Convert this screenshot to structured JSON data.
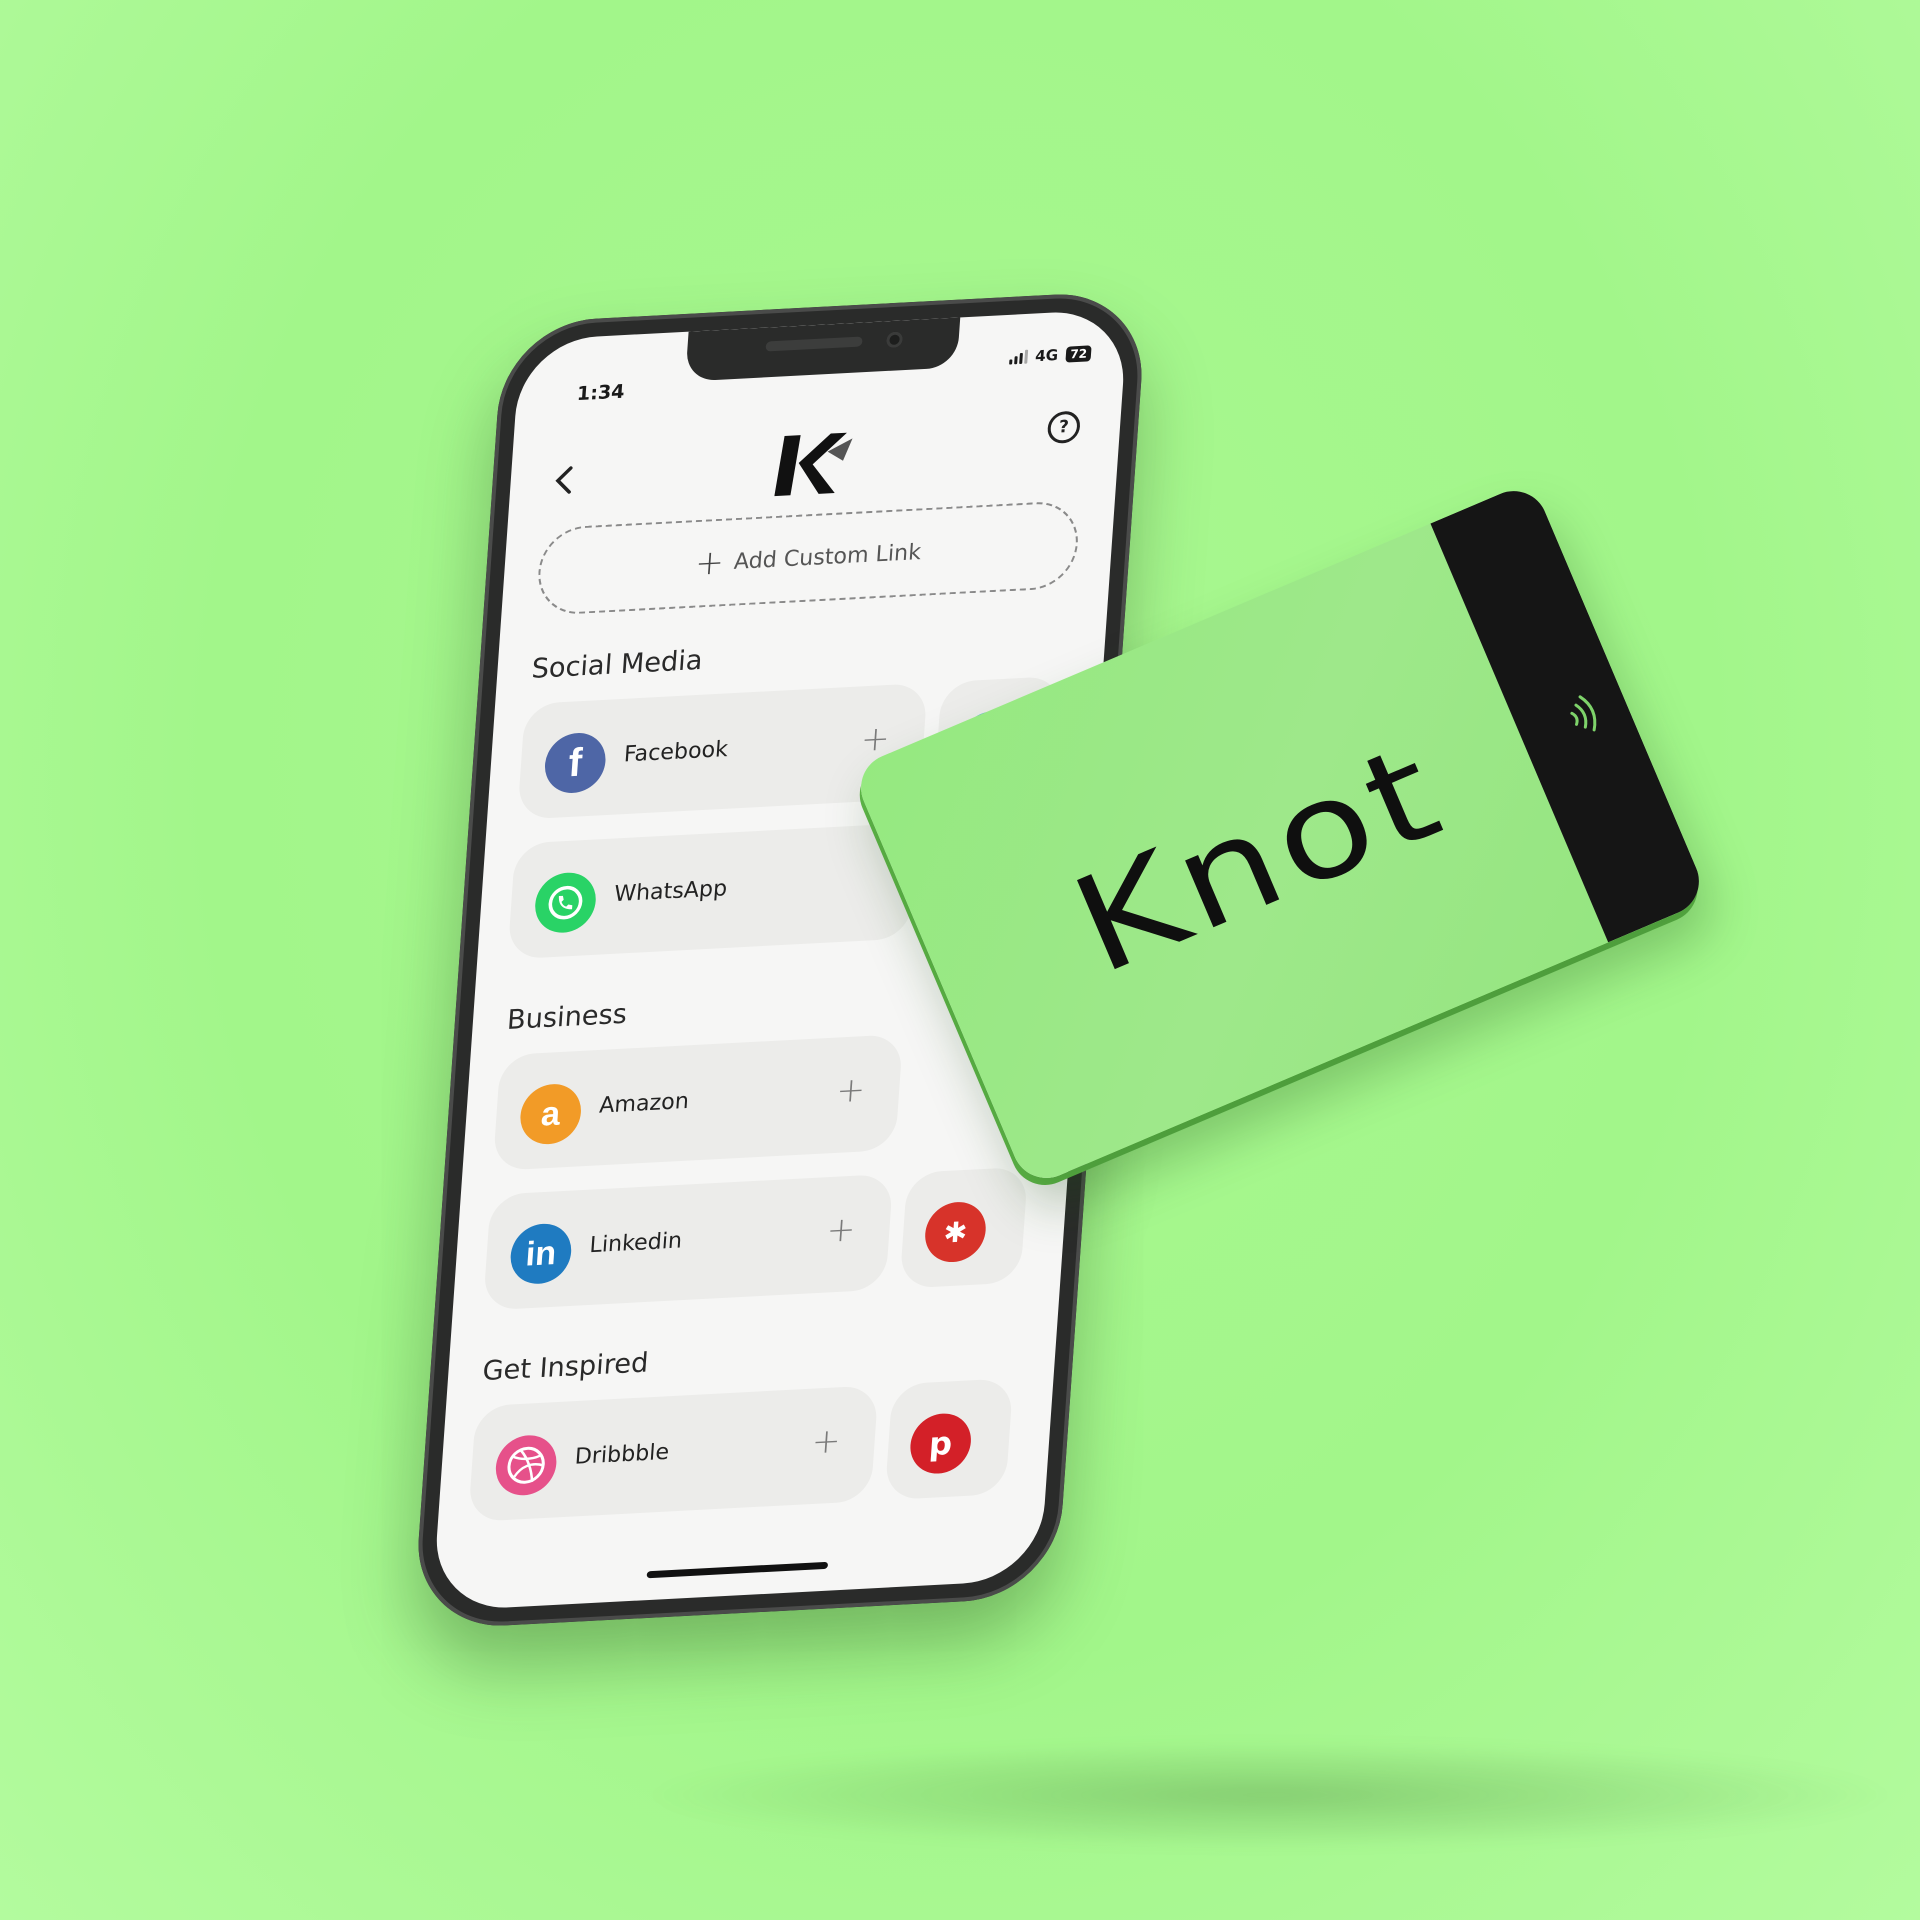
{
  "status_bar": {
    "time": "1:34",
    "network": "4G",
    "battery": "72"
  },
  "header": {
    "back_icon": "chevron-left-icon",
    "logo_icon": "knot-logo-icon",
    "help_icon": "question-icon"
  },
  "custom_link": {
    "label": "Add Custom Link"
  },
  "sections": {
    "social": {
      "title": "Social Media"
    },
    "business": {
      "title": "Business"
    },
    "inspired": {
      "title": "Get Inspired"
    }
  },
  "links": {
    "facebook": {
      "label": "Facebook",
      "icon": "facebook-icon",
      "color": "#4e66a6"
    },
    "whatsapp": {
      "label": "WhatsApp",
      "icon": "whatsapp-icon",
      "color": "#29d366"
    },
    "amazon": {
      "label": "Amazon",
      "icon": "amazon-icon",
      "color": "#f29b27"
    },
    "linkedin": {
      "label": "Linkedin",
      "icon": "linkedin-icon",
      "color": "#1f7bc1"
    },
    "dribbble": {
      "label": "Dribbble",
      "icon": "dribbble-icon",
      "color": "#e6518a"
    },
    "yelp": {
      "icon": "yelp-icon",
      "color": "#d7332a"
    },
    "pinterest": {
      "icon": "pinterest-icon",
      "color": "#d32028"
    }
  },
  "card": {
    "brand": "Knot",
    "nfc_icon": "nfc-icon",
    "color": "#9ce888"
  }
}
